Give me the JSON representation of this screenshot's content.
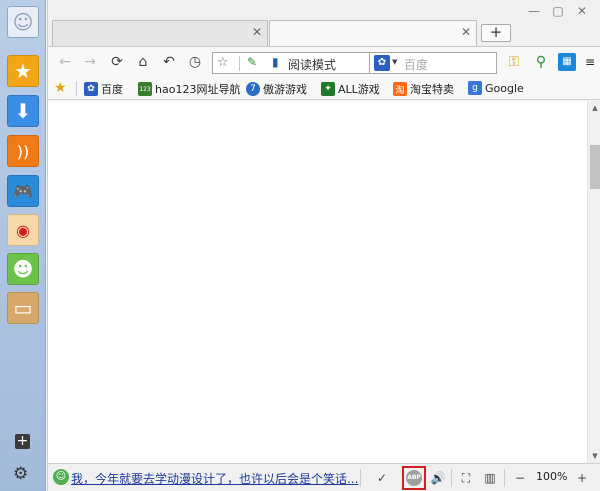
{
  "tabs": [
    {
      "label": ""
    },
    {
      "label": ""
    }
  ],
  "toolbar": {
    "reading_mode": "阅读模式",
    "search_placeholder": "百度"
  },
  "bookmarks": [
    {
      "label": "百度",
      "icon": "baidu-paw-icon",
      "color": "#2e5ebf"
    },
    {
      "label": "hao123网址导航",
      "icon": "hao123-icon",
      "color": "#3a7d2f"
    },
    {
      "label": "傲游游戏",
      "icon": "maxthon-game-icon",
      "color": "#2a6cc6"
    },
    {
      "label": "ALL游戏",
      "icon": "all-game-icon",
      "color": "#1f7a2a"
    },
    {
      "label": "淘宝特卖",
      "icon": "taobao-icon",
      "color": "#ff6a1a"
    },
    {
      "label": "Google",
      "icon": "google-icon",
      "color": "#3a74d8"
    }
  ],
  "status": {
    "message": "我，今年就要去学动漫设计了，也许以后会是个笑话...",
    "abp_label": "ABP",
    "zoom": "100%"
  },
  "sidebar": {
    "items": [
      {
        "icon": "smiley-icon",
        "color": "#e9eef6"
      },
      {
        "icon": "favorites-star-icon",
        "color": "#f3a615"
      },
      {
        "icon": "download-icon",
        "color": "#3a8ee6"
      },
      {
        "icon": "rss-icon",
        "color": "#f07a18"
      },
      {
        "icon": "gamepad-icon",
        "color": "#2a8bd8"
      },
      {
        "icon": "weibo-icon",
        "color": "#f4d8a8"
      },
      {
        "icon": "emoji-icon",
        "color": "#6cc24a"
      },
      {
        "icon": "note-icon",
        "color": "#d7a86a"
      }
    ]
  }
}
